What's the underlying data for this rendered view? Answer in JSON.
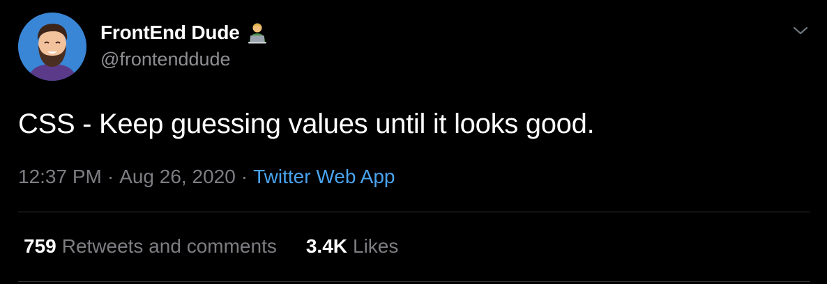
{
  "author": {
    "display_name": "FrontEnd Dude",
    "handle": "@frontenddude",
    "name_emoji_icon": "man-technologist-icon"
  },
  "tweet": {
    "text": "CSS - Keep guessing values until it looks good.",
    "time": "12:37 PM",
    "separator": "·",
    "date": "Aug 26, 2020",
    "source": "Twitter Web App"
  },
  "stats": {
    "retweets_count": "759",
    "retweets_label": "Retweets and comments",
    "likes_count": "3.4K",
    "likes_label": "Likes"
  },
  "colors": {
    "background": "#000000",
    "primary_text": "#ffffff",
    "secondary_text": "#7d7d82",
    "link": "#4aa3ef",
    "divider": "#2f3336",
    "avatar_background": "#3a86d6"
  },
  "icons": {
    "caret": "chevron-down-icon",
    "avatar": "avatar"
  }
}
